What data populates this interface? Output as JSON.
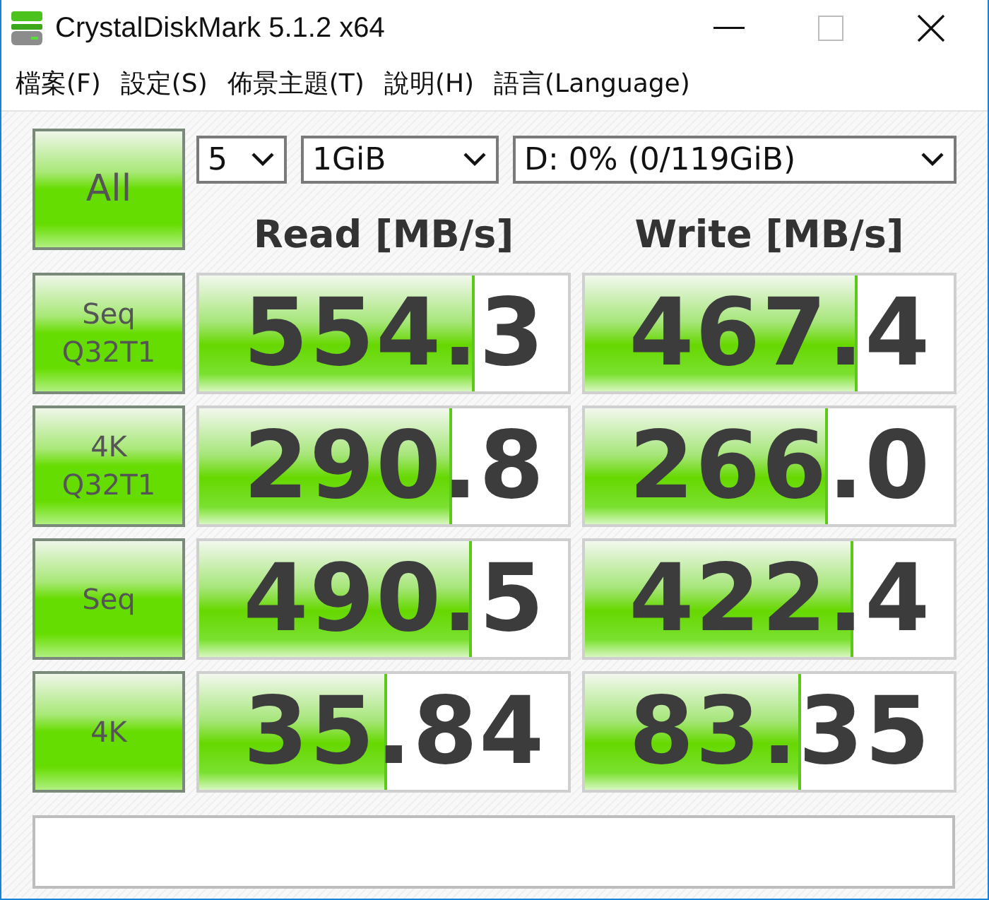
{
  "window": {
    "title": "CrystalDiskMark 5.1.2 x64"
  },
  "menu": [
    "檔案(F)",
    "設定(S)",
    "佈景主題(T)",
    "說明(H)",
    "語言(Language)"
  ],
  "all_button": "All",
  "selects": [
    {
      "value": "5"
    },
    {
      "value": "1GiB"
    },
    {
      "value": "D: 0% (0/119GiB)"
    }
  ],
  "columns": [
    "Read [MB/s]",
    "Write [MB/s]"
  ],
  "rows": [
    {
      "label": [
        "Seq",
        "Q32T1"
      ],
      "read": {
        "value": "554.3",
        "level": 0.74
      },
      "write": {
        "value": "467.4",
        "level": 0.73
      }
    },
    {
      "label": [
        "4K",
        "Q32T1"
      ],
      "read": {
        "value": "290.8",
        "level": 0.68
      },
      "write": {
        "value": "266.0",
        "level": 0.65
      }
    },
    {
      "label": [
        "Seq"
      ],
      "read": {
        "value": "490.5",
        "level": 0.73
      },
      "write": {
        "value": "422.4",
        "level": 0.72
      }
    },
    {
      "label": [
        "4K"
      ],
      "read": {
        "value": "35.84",
        "level": 0.5
      },
      "write": {
        "value": "83.35",
        "level": 0.58
      }
    }
  ]
}
